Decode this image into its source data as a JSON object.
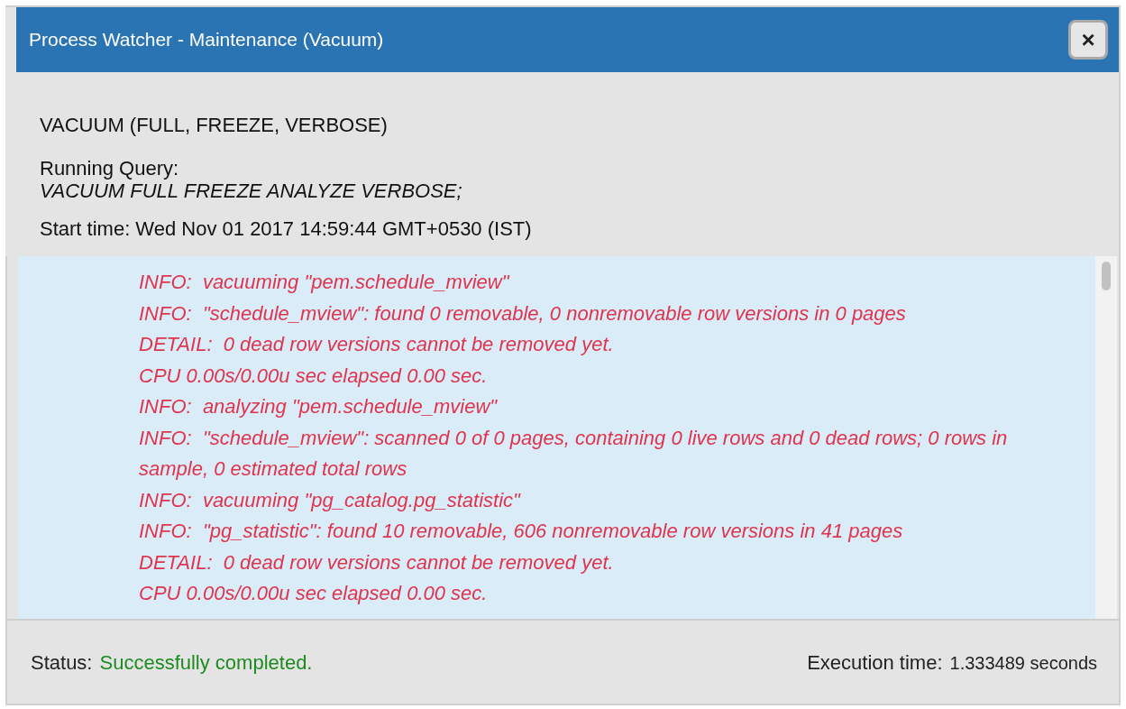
{
  "window": {
    "title": "Process Watcher - Maintenance (Vacuum)",
    "close_label": "×"
  },
  "info": {
    "operation": "VACUUM (FULL, FREEZE, VERBOSE)",
    "query_label": "Running Query:",
    "query": "VACUUM FULL FREEZE ANALYZE VERBOSE;",
    "start_time": "Start time: Wed Nov 01 2017 14:59:44 GMT+0530 (IST)"
  },
  "log": [
    "INFO:  vacuuming \"pem.schedule_mview\"",
    "INFO:  \"schedule_mview\": found 0 removable, 0 nonremovable row versions in 0 pages",
    "DETAIL:  0 dead row versions cannot be removed yet.",
    "CPU 0.00s/0.00u sec elapsed 0.00 sec.",
    "INFO:  analyzing \"pem.schedule_mview\"",
    "INFO:  \"schedule_mview\": scanned 0 of 0 pages, containing 0 live rows and 0 dead rows; 0 rows in sample, 0 estimated total rows",
    "INFO:  vacuuming \"pg_catalog.pg_statistic\"",
    "INFO:  \"pg_statistic\": found 10 removable, 606 nonremovable row versions in 41 pages",
    "DETAIL:  0 dead row versions cannot be removed yet.",
    "CPU 0.00s/0.00u sec elapsed 0.00 sec."
  ],
  "status_bar": {
    "status_label": "Status:",
    "status": "Successfully completed.",
    "execution_label": "Execution time:",
    "execution_time": "1.333489 seconds"
  }
}
